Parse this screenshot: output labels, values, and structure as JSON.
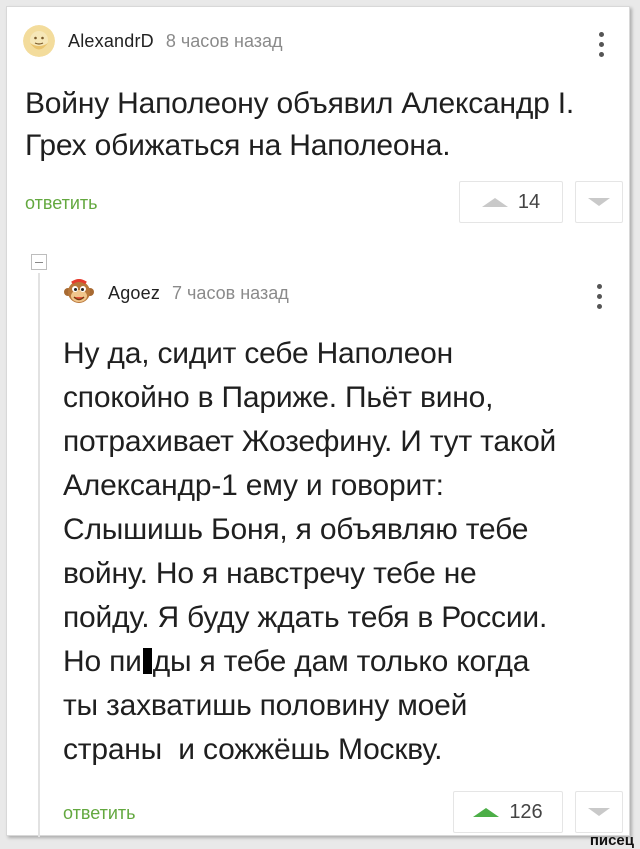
{
  "comments": [
    {
      "username": "AlexandrD",
      "time": "8 часов назад",
      "text": "Войну Наполеону объявил Александр I. Грех обижаться на Наполеона.",
      "reply_label": "ответить",
      "votes": "14",
      "avatar_icon": "bearded-face-avatar-icon"
    },
    {
      "username": "Agoez",
      "time": "7 часов назад",
      "text_lines": [
        "Ну да, сидит себе Наполеон",
        "спокойно в Париже. Пьёт вино,",
        "потрахивает Жозефину. И тут такой",
        "Александр-1 ему и говорит:",
        "Слышишь Боня, я объявляю тебе",
        "войну. Но я навстречу тебе не",
        "пойду. Я буду ждать тебя в России."
      ],
      "text_line8_before": "Но пи",
      "text_line8_after": "ды я тебе дам только когда",
      "text_line9": "ты захватишь половину моей",
      "text_line10": "страны  и сожжёшь Москву.",
      "reply_label": "ответить",
      "votes": "126",
      "avatar_icon": "monkey-avatar-icon"
    }
  ],
  "watermark": "писец",
  "colors": {
    "reply": "#63a83f",
    "upvote_active": "#4cae47",
    "vote_inactive": "#c9c9c9"
  }
}
